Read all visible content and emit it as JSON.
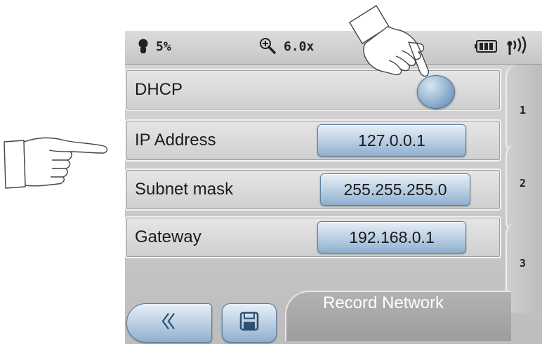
{
  "status_bar": {
    "brightness_value": "5%",
    "zoom_value": "6.0x",
    "icons": [
      "bulb-icon",
      "zoom-in-icon",
      "battery-icon",
      "signal-icon"
    ]
  },
  "rows": [
    {
      "label": "DHCP",
      "control": "toggle"
    },
    {
      "label": "IP Address",
      "value": "127.0.0.1"
    },
    {
      "label": "Subnet mask",
      "value": "255.255.255.0"
    },
    {
      "label": "Gateway",
      "value": "192.168.0.1"
    }
  ],
  "tabs": [
    "1",
    "2",
    "3"
  ],
  "bottom": {
    "screen_title": "Record Network",
    "back_icon": "double-chevron-left-icon",
    "save_icon": "floppy-disk-icon"
  },
  "colors": {
    "button_blue": "#b8cde2",
    "button_border": "#5c7f9f",
    "panel_gray": "#cfcfcf"
  }
}
